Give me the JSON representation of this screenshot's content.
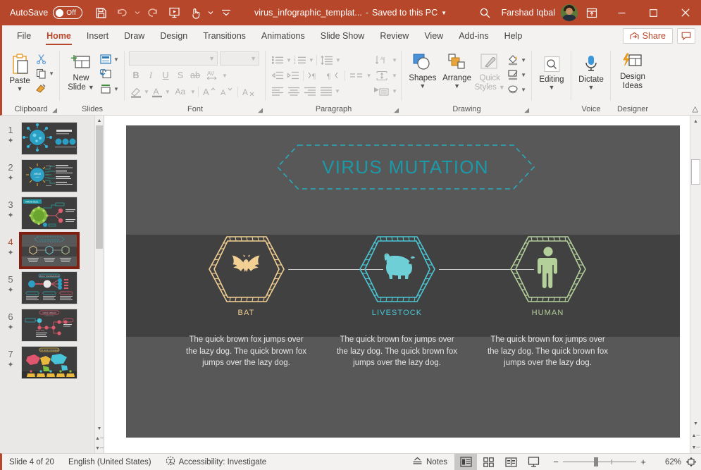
{
  "titlebar": {
    "autosave_label": "AutoSave",
    "autosave_state": "Off",
    "quick_access": [
      {
        "name": "save-icon",
        "tooltip": "Save"
      },
      {
        "name": "undo-icon",
        "tooltip": "Undo"
      },
      {
        "name": "redo-icon",
        "tooltip": "Redo"
      },
      {
        "name": "start-from-beginning-icon",
        "tooltip": "Start From Beginning"
      },
      {
        "name": "touch-mode-icon",
        "tooltip": "Touch/Mouse Mode"
      },
      {
        "name": "customize-quick-access-icon",
        "tooltip": "Customize Quick Access Toolbar"
      }
    ],
    "document_name": "virus_infographic_templat...",
    "save_state": "Saved to this PC",
    "user_name": "Farshad Iqbal",
    "window_buttons": {
      "minimize": "—",
      "maximize": "□",
      "close": "✕"
    }
  },
  "ribbon": {
    "tabs": [
      {
        "label": "File",
        "active": false
      },
      {
        "label": "Home",
        "active": true
      },
      {
        "label": "Insert",
        "active": false
      },
      {
        "label": "Draw",
        "active": false
      },
      {
        "label": "Design",
        "active": false
      },
      {
        "label": "Transitions",
        "active": false
      },
      {
        "label": "Animations",
        "active": false
      },
      {
        "label": "Slide Show",
        "active": false
      },
      {
        "label": "Review",
        "active": false
      },
      {
        "label": "View",
        "active": false
      },
      {
        "label": "Add-ins",
        "active": false
      },
      {
        "label": "Help",
        "active": false
      }
    ],
    "share_label": "Share",
    "groups": {
      "clipboard": {
        "label": "Clipboard",
        "paste_label": "Paste",
        "items": [
          "cut-icon",
          "copy-icon",
          "format-painter-icon"
        ]
      },
      "slides": {
        "label": "Slides",
        "new_slide_label": "New\nSlide",
        "new_slide_line1": "New",
        "new_slide_line2": "Slide",
        "items": [
          "layout-icon",
          "reset-icon",
          "section-icon"
        ]
      },
      "font": {
        "label": "Font",
        "font_name_value": "",
        "font_size_value": "",
        "buttons": [
          "bold",
          "italic",
          "underline",
          "text-shadow",
          "strikethrough",
          "character-spacing",
          "text-highlight",
          "font-color",
          "change-case",
          "increase-font-size",
          "decrease-font-size",
          "clear-formatting"
        ]
      },
      "paragraph": {
        "label": "Paragraph",
        "buttons": [
          "bullets",
          "numbering",
          "line-spacing",
          "text-direction",
          "decrease-indent",
          "increase-indent",
          "ltr-text-direction",
          "rtl-text-direction",
          "columns",
          "align-text",
          "align-left",
          "align-center",
          "align-right",
          "justify",
          "convert-to-smartart"
        ]
      },
      "drawing": {
        "label": "Drawing",
        "shapes_label": "Shapes",
        "arrange_label": "Arrange",
        "quick_styles_label": "Quick\nStyles",
        "quick_styles_line1": "Quick",
        "quick_styles_line2": "Styles",
        "items": [
          "shape-fill-icon",
          "shape-outline-icon",
          "shape-effects-icon"
        ]
      },
      "editing": {
        "label": "",
        "editing_label": "Editing"
      },
      "voice": {
        "label": "Voice",
        "dictate_label": "Dictate"
      },
      "designer": {
        "label": "Designer",
        "design_ideas_line1": "Design",
        "design_ideas_line2": "Ideas"
      }
    }
  },
  "thumbnails": [
    {
      "number": "1",
      "animated": true,
      "selected": false
    },
    {
      "number": "2",
      "animated": true,
      "selected": false
    },
    {
      "number": "3",
      "animated": true,
      "selected": false
    },
    {
      "number": "4",
      "animated": true,
      "selected": true
    },
    {
      "number": "5",
      "animated": true,
      "selected": false
    },
    {
      "number": "6",
      "animated": true,
      "selected": false
    },
    {
      "number": "7",
      "animated": true,
      "selected": false
    }
  ],
  "slide": {
    "title": "VIRUS MUTATION",
    "title_color": "#1a9aa8",
    "background_color": "#585858",
    "band_color": "#414141",
    "nodes": [
      {
        "label": "BAT",
        "color": "#f2cf92",
        "icon": "bat-icon"
      },
      {
        "label": "LIVESTOCK",
        "color": "#6fcfd6",
        "icon": "pig-icon"
      },
      {
        "label": "HUMAN",
        "color": "#b3cf9a",
        "icon": "person-icon"
      }
    ],
    "body_texts": [
      "The quick brown fox jumps over the lazy dog. The quick brown fox jumps over the lazy dog.",
      "The quick brown fox jumps over the lazy dog. The quick brown fox jumps over the lazy dog.",
      "The quick brown fox jumps over the lazy dog. The quick brown fox jumps over the lazy dog."
    ]
  },
  "status": {
    "slide_counter": "Slide 4 of 20",
    "language": "English (United States)",
    "accessibility": "Accessibility: Investigate",
    "notes_label": "Notes",
    "views": [
      "normal-view",
      "slide-sorter-view",
      "reading-view",
      "slide-show-view"
    ],
    "zoom_level": "62%",
    "zoom_out": "−",
    "zoom_in": "+"
  }
}
